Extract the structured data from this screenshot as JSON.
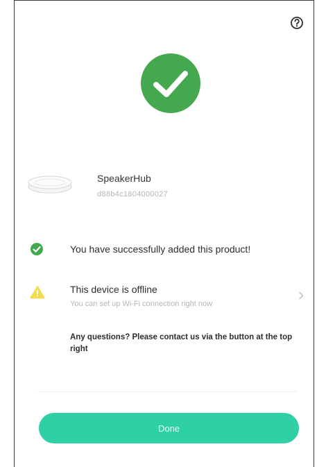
{
  "header": {
    "help_icon": "question-circle-icon"
  },
  "success": {
    "icon": "check-circle-icon",
    "color": "#44a94e"
  },
  "device": {
    "image_icon": "speaker-hub-image",
    "name": "SpeakerHub",
    "id": "d88b4c1804000027"
  },
  "messages": {
    "success_icon": "check-circle-small-icon",
    "success_text": "You have successfully added this product!",
    "offline_icon": "warning-triangle-icon",
    "offline_title": "This device is offline",
    "offline_subtitle": "You can set up Wi-Fi connection right now",
    "offline_chevron": "chevron-right-icon",
    "questions_text": "Any questions? Please contact us via the button at the top right"
  },
  "actions": {
    "done_label": "Done"
  },
  "colors": {
    "success_green": "#44a94e",
    "warning_yellow": "#f5dc4c",
    "button_teal": "#2fd0a5"
  }
}
